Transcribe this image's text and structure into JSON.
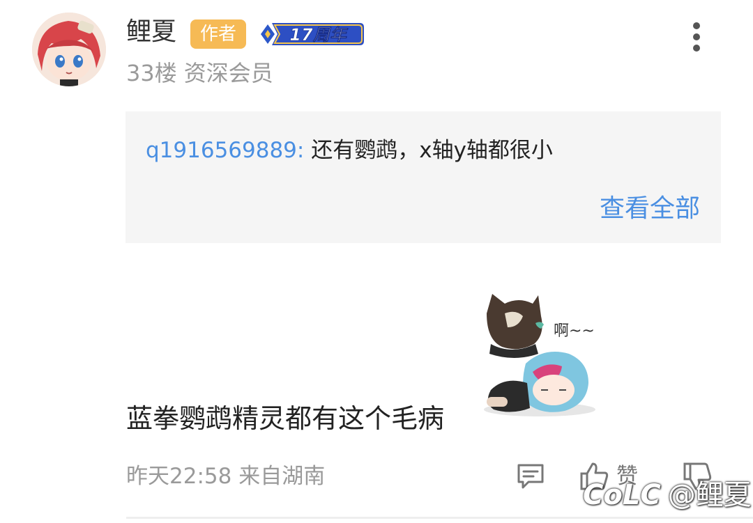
{
  "post": {
    "username": "鲤夏",
    "author_badge": "作者",
    "anniversary_badge": "17周年",
    "floor": "33楼",
    "member_level": "资深会员",
    "quote": {
      "user": "q1916569889:",
      "text": "还有鹦鹉，x轴y轴都很小",
      "view_all": "查看全部"
    },
    "sticker_text": "啊~~",
    "content": "蓝拳鹦鹉精灵都有这个毛病",
    "time_location": "昨天22:58 来自湖南",
    "like_label": "赞"
  },
  "watermark": {
    "logo": "CoLC",
    "handle": "@鲤夏"
  },
  "colors": {
    "link_blue": "#4a8fe2",
    "author_badge": "#f6ba55",
    "meta_gray": "#9a9a9a",
    "quote_bg": "#f5f5f5"
  },
  "icons": [
    "avatar",
    "more-vertical-icon",
    "reply-icon",
    "thumbs-up-icon",
    "thumbs-down-icon"
  ]
}
